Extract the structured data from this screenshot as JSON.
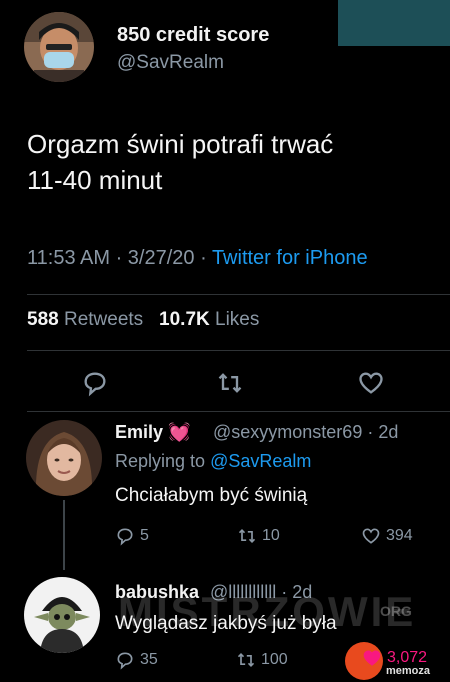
{
  "main_tweet": {
    "name": "850 credit score",
    "handle": "@SavRealm",
    "text_line1": "Orgazm świni potrafi trwać",
    "text_line2": "11-40 minut",
    "time_date": "11:53 AM · 3/27/20 · ",
    "source": "Twitter for iPhone",
    "retweets_count": "588",
    "retweets_label": "Retweets",
    "likes_count": "10.7K",
    "likes_label": "Likes"
  },
  "replies": [
    {
      "name": "Emily",
      "emoji": "💓",
      "handle_meta": "@sexyymonster69 · 2d",
      "replying_prefix": "Replying to ",
      "replying_to": "@SavRealm",
      "text": "Chciałabym być świnią",
      "reply_count": "5",
      "retweet_count": "10",
      "like_count": "394"
    },
    {
      "name": "babushka",
      "handle_meta": "@llllllllllll · 2d",
      "text": "Wyglądasz jakbyś już była",
      "reply_count": "35",
      "retweet_count": "100",
      "like_count": "3,072"
    }
  ],
  "watermark": {
    "text": "MISTRZOWIE",
    "badge": "ORG",
    "memoza": "memoza"
  },
  "colors": {
    "background": "#000000",
    "link": "#1d9bf0",
    "muted": "#8b98a5",
    "like": "#f91880",
    "teal_block": "#1d4f57"
  },
  "icons": [
    "reply-icon",
    "retweet-icon",
    "like-icon"
  ]
}
